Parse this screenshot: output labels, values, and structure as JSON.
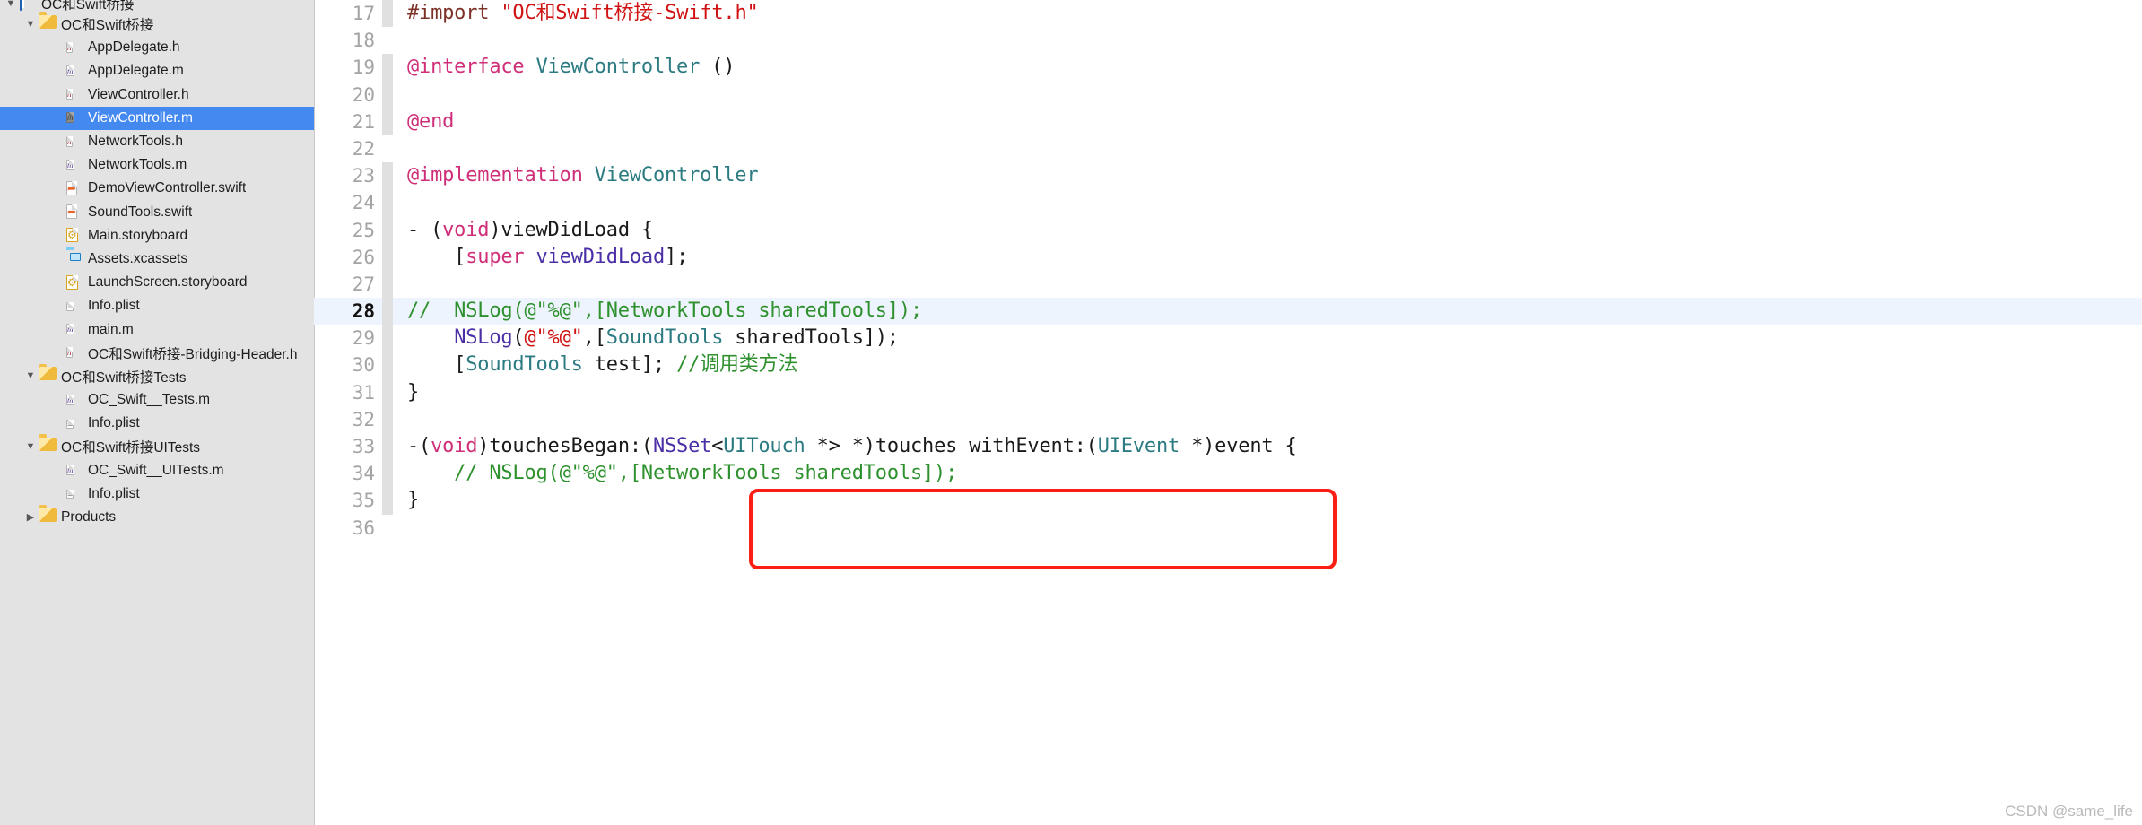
{
  "colors": {
    "sidebar_bg": "#e3e3e3",
    "selection_blue": "#4389f0",
    "current_line_bg": "#eef4fd",
    "annotation_red": "#fa1e14",
    "editor_bg": "#ffffff",
    "gutter_text": "#a4a4a4",
    "syntax_preprocessor": "#7c3227",
    "syntax_string": "#d01212",
    "syntax_keyword": "#cf2e78",
    "syntax_type": "#2d7b82",
    "syntax_function": "#4b2fa6",
    "syntax_comment": "#2e912e"
  },
  "sidebar": {
    "items": [
      {
        "label": "OC和Swift桥接",
        "icon": "xcode-project-icon",
        "indent": 0,
        "disclosure": "▼",
        "selected": false,
        "clipped_top": true
      },
      {
        "label": "OC和Swift桥接",
        "icon": "folder-icon",
        "indent": 1,
        "disclosure": "▼",
        "selected": false
      },
      {
        "label": "AppDelegate.h",
        "icon": "header-file-icon",
        "indent": 2,
        "disclosure": "",
        "selected": false
      },
      {
        "label": "AppDelegate.m",
        "icon": "objc-file-icon",
        "indent": 2,
        "disclosure": "",
        "selected": false
      },
      {
        "label": "ViewController.h",
        "icon": "header-file-icon",
        "indent": 2,
        "disclosure": "",
        "selected": false
      },
      {
        "label": "ViewController.m",
        "icon": "objc-file-icon-selected",
        "indent": 2,
        "disclosure": "",
        "selected": true
      },
      {
        "label": "NetworkTools.h",
        "icon": "header-file-icon",
        "indent": 2,
        "disclosure": "",
        "selected": false
      },
      {
        "label": "NetworkTools.m",
        "icon": "objc-file-icon",
        "indent": 2,
        "disclosure": "",
        "selected": false
      },
      {
        "label": "DemoViewController.swift",
        "icon": "swift-file-icon",
        "indent": 2,
        "disclosure": "",
        "selected": false
      },
      {
        "label": "SoundTools.swift",
        "icon": "swift-file-icon",
        "indent": 2,
        "disclosure": "",
        "selected": false
      },
      {
        "label": "Main.storyboard",
        "icon": "storyboard-file-icon",
        "indent": 2,
        "disclosure": "",
        "selected": false
      },
      {
        "label": "Assets.xcassets",
        "icon": "xcassets-icon",
        "indent": 2,
        "disclosure": "",
        "selected": false
      },
      {
        "label": "LaunchScreen.storyboard",
        "icon": "storyboard-file-icon",
        "indent": 2,
        "disclosure": "",
        "selected": false
      },
      {
        "label": "Info.plist",
        "icon": "plist-file-icon",
        "indent": 2,
        "disclosure": "",
        "selected": false
      },
      {
        "label": "main.m",
        "icon": "objc-file-icon",
        "indent": 2,
        "disclosure": "",
        "selected": false
      },
      {
        "label": "OC和Swift桥接-Bridging-Header.h",
        "icon": "header-file-icon",
        "indent": 2,
        "disclosure": "",
        "selected": false
      },
      {
        "label": "OC和Swift桥接Tests",
        "icon": "folder-icon",
        "indent": 1,
        "disclosure": "▼",
        "selected": false
      },
      {
        "label": "OC_Swift__Tests.m",
        "icon": "objc-file-icon",
        "indent": 2,
        "disclosure": "",
        "selected": false
      },
      {
        "label": "Info.plist",
        "icon": "plist-file-icon",
        "indent": 2,
        "disclosure": "",
        "selected": false
      },
      {
        "label": "OC和Swift桥接UITests",
        "icon": "folder-icon",
        "indent": 1,
        "disclosure": "▼",
        "selected": false
      },
      {
        "label": "OC_Swift__UITests.m",
        "icon": "objc-file-icon",
        "indent": 2,
        "disclosure": "",
        "selected": false
      },
      {
        "label": "Info.plist",
        "icon": "plist-file-icon",
        "indent": 2,
        "disclosure": "",
        "selected": false
      },
      {
        "label": "Products",
        "icon": "folder-icon",
        "indent": 1,
        "disclosure": "▶",
        "selected": false
      }
    ]
  },
  "editor": {
    "lines": [
      {
        "num": "17",
        "fold": true,
        "current": false,
        "tokens": [
          {
            "t": "#import ",
            "c": "pre"
          },
          {
            "t": "\"OC和Swift桥接-Swift.h\"",
            "c": "str"
          }
        ]
      },
      {
        "num": "18",
        "fold": false,
        "current": false,
        "tokens": []
      },
      {
        "num": "19",
        "fold": true,
        "current": false,
        "tokens": [
          {
            "t": "@interface",
            "c": "kw"
          },
          {
            "t": " ",
            "c": "plain"
          },
          {
            "t": "ViewController",
            "c": "type"
          },
          {
            "t": " ()",
            "c": "plain"
          }
        ]
      },
      {
        "num": "20",
        "fold": true,
        "current": false,
        "tokens": []
      },
      {
        "num": "21",
        "fold": true,
        "current": false,
        "tokens": [
          {
            "t": "@end",
            "c": "kw"
          }
        ]
      },
      {
        "num": "22",
        "fold": false,
        "current": false,
        "tokens": []
      },
      {
        "num": "23",
        "fold": true,
        "current": false,
        "tokens": [
          {
            "t": "@implementation",
            "c": "kw"
          },
          {
            "t": " ",
            "c": "plain"
          },
          {
            "t": "ViewController",
            "c": "type"
          }
        ]
      },
      {
        "num": "24",
        "fold": true,
        "current": false,
        "tokens": []
      },
      {
        "num": "25",
        "fold": true,
        "current": false,
        "tokens": [
          {
            "t": "- (",
            "c": "plain"
          },
          {
            "t": "void",
            "c": "kw"
          },
          {
            "t": ")viewDidLoad {",
            "c": "plain"
          }
        ]
      },
      {
        "num": "26",
        "fold": true,
        "current": false,
        "tokens": [
          {
            "t": "    [",
            "c": "plain"
          },
          {
            "t": "super",
            "c": "kw"
          },
          {
            "t": " ",
            "c": "plain"
          },
          {
            "t": "viewDidLoad",
            "c": "fn"
          },
          {
            "t": "];",
            "c": "plain"
          }
        ]
      },
      {
        "num": "27",
        "fold": true,
        "current": false,
        "tokens": []
      },
      {
        "num": "28",
        "fold": true,
        "current": true,
        "tokens": [
          {
            "t": "//  NSLog(@\"%@\",[NetworkTools sharedTools]);",
            "c": "cmt"
          }
        ]
      },
      {
        "num": "29",
        "fold": true,
        "current": false,
        "tokens": [
          {
            "t": "    ",
            "c": "plain"
          },
          {
            "t": "NSLog",
            "c": "fn"
          },
          {
            "t": "(",
            "c": "plain"
          },
          {
            "t": "@\"%@\"",
            "c": "str"
          },
          {
            "t": ",[",
            "c": "plain"
          },
          {
            "t": "SoundTools",
            "c": "type"
          },
          {
            "t": " sharedTools]);",
            "c": "plain"
          }
        ]
      },
      {
        "num": "30",
        "fold": true,
        "current": false,
        "tokens": [
          {
            "t": "    [",
            "c": "plain"
          },
          {
            "t": "SoundTools",
            "c": "type"
          },
          {
            "t": " test]; ",
            "c": "plain"
          },
          {
            "t": "//调用类方法",
            "c": "cmt"
          }
        ]
      },
      {
        "num": "31",
        "fold": true,
        "current": false,
        "tokens": [
          {
            "t": "}",
            "c": "plain"
          }
        ]
      },
      {
        "num": "32",
        "fold": true,
        "current": false,
        "tokens": []
      },
      {
        "num": "33",
        "fold": true,
        "current": false,
        "tokens": [
          {
            "t": "-(",
            "c": "plain"
          },
          {
            "t": "void",
            "c": "kw"
          },
          {
            "t": ")touchesBegan:(",
            "c": "plain"
          },
          {
            "t": "NSSet",
            "c": "fn"
          },
          {
            "t": "<",
            "c": "plain"
          },
          {
            "t": "UITouch",
            "c": "type"
          },
          {
            "t": " *> *)touches withEvent:(",
            "c": "plain"
          },
          {
            "t": "UIEvent",
            "c": "type"
          },
          {
            "t": " *)event {",
            "c": "plain"
          }
        ]
      },
      {
        "num": "34",
        "fold": true,
        "current": false,
        "tokens": [
          {
            "t": "    // NSLog(@\"%@\",[NetworkTools sharedTools]);",
            "c": "cmt"
          }
        ]
      },
      {
        "num": "35",
        "fold": true,
        "current": false,
        "tokens": [
          {
            "t": "}",
            "c": "plain"
          }
        ]
      },
      {
        "num": "36",
        "fold": false,
        "current": false,
        "tokens": []
      }
    ]
  },
  "annotation": {
    "shape": "rounded-rectangle",
    "color": "#fa1e14",
    "covers_lines": [
      "29",
      "30"
    ]
  },
  "watermark": {
    "text": "CSDN @same_life"
  }
}
